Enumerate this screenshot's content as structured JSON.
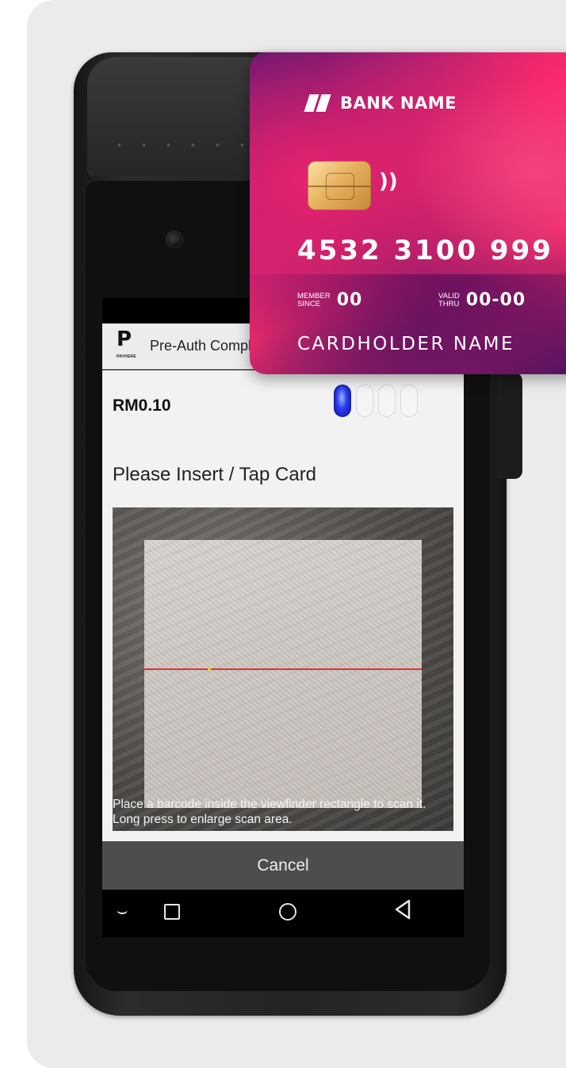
{
  "app": {
    "logo_mark": "P",
    "logo_word": "PAYHERE",
    "title": "Pre-Auth Completion"
  },
  "payment": {
    "amount": "RM0.10",
    "card_read_progress": {
      "active": 1,
      "total": 4
    },
    "prompt": "Please Insert / Tap Card"
  },
  "scanner": {
    "hint": "Place a barcode inside the viewfinder rectangle to scan it. Long press to enlarge scan area."
  },
  "actions": {
    "cancel_label": "Cancel"
  },
  "navigation": {
    "icons": [
      "hide-keyboard-icon",
      "recents-icon",
      "home-icon",
      "back-icon"
    ]
  },
  "card": {
    "bank_name": "BANK NAME",
    "number": "4532  3100  999",
    "member_since_label_1": "MEMBER",
    "member_since_label_2": "SINCE",
    "member_since": "00",
    "valid_thru_label_1": "VALID",
    "valid_thru_label_2": "THRU",
    "valid_thru": "00-00",
    "cardholder": "CARDHOLDER NAME",
    "contactless_glyph": "))"
  },
  "colors": {
    "indicator_active": "#1a24b0",
    "cancel_bg": "#4d4d4d",
    "scan_line": "#e0342e",
    "card_accent": "#e72a6a"
  }
}
